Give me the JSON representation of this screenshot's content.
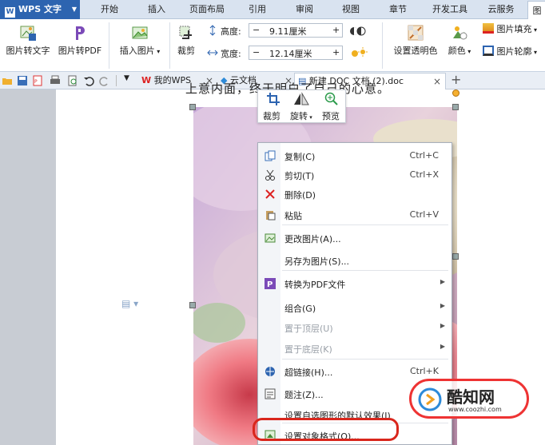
{
  "app": {
    "name": "WPS 文字"
  },
  "menu": {
    "tabs": [
      "开始",
      "插入",
      "页面布局",
      "引用",
      "审阅",
      "视图",
      "章节",
      "开发工具",
      "云服务",
      "图"
    ]
  },
  "ribbon": {
    "pic_to_text": "图片转文字",
    "pic_to_pdf": "图片转PDF",
    "insert_picture": "插入图片",
    "crop": "裁剪",
    "height_label": "高度:",
    "height_value": "9.11厘米",
    "width_label": "宽度:",
    "width_value": "12.14厘米",
    "set_transparent": "设置透明色",
    "color": "颜色",
    "pic_fill": "图片填充",
    "pic_outline": "图片轮廓",
    "minus": "−",
    "plus": "+"
  },
  "doctabs": [
    {
      "label": "我的WPS"
    },
    {
      "label": "云文档"
    },
    {
      "label": "新建 DOC 文档 (2).doc"
    }
  ],
  "document": {
    "top_text": "上意内面，终于明白了自己的心意。"
  },
  "floatbar": {
    "crop": "裁剪",
    "rotate": "旋转",
    "preview": "预览"
  },
  "context_menu": [
    {
      "label": "复制(C)",
      "shortcut": "Ctrl+C",
      "icon": "copy-icon",
      "submenu": false,
      "disabled": false
    },
    {
      "label": "剪切(T)",
      "shortcut": "Ctrl+X",
      "icon": "scissors-icon",
      "submenu": false,
      "disabled": false
    },
    {
      "label": "删除(D)",
      "shortcut": "",
      "icon": "delete-x-icon",
      "submenu": false,
      "disabled": false
    },
    {
      "label": "粘贴",
      "shortcut": "Ctrl+V",
      "icon": "paste-icon",
      "submenu": false,
      "disabled": false
    },
    {
      "label": "更改图片(A)...",
      "shortcut": "",
      "icon": "change-picture-icon",
      "submenu": false,
      "disabled": false
    },
    {
      "label": "另存为图片(S)...",
      "shortcut": "",
      "icon": "",
      "submenu": false,
      "disabled": false
    },
    {
      "label": "转换为PDF文件",
      "shortcut": "",
      "icon": "pdf-icon",
      "submenu": true,
      "disabled": false
    },
    {
      "label": "组合(G)",
      "shortcut": "",
      "icon": "",
      "submenu": true,
      "disabled": false
    },
    {
      "label": "置于顶层(U)",
      "shortcut": "",
      "icon": "",
      "submenu": true,
      "disabled": true
    },
    {
      "label": "置于底层(K)",
      "shortcut": "",
      "icon": "",
      "submenu": true,
      "disabled": true
    },
    {
      "label": "超链接(H)...",
      "shortcut": "Ctrl+K",
      "icon": "hyperlink-icon",
      "submenu": false,
      "disabled": false
    },
    {
      "label": "题注(Z)...",
      "shortcut": "",
      "icon": "caption-icon",
      "submenu": false,
      "disabled": false
    },
    {
      "label": "设置自选图形的默认效果(I)",
      "shortcut": "",
      "icon": "",
      "submenu": false,
      "disabled": false
    },
    {
      "label": "设置对象格式(O)...",
      "shortcut": "",
      "icon": "format-object-icon",
      "submenu": false,
      "disabled": false
    }
  ],
  "watermark": {
    "brand": "酷知网",
    "url": "www.coozhi.com"
  },
  "colors": {
    "accent": "#2d64b0",
    "highlight": "#d9261c"
  }
}
